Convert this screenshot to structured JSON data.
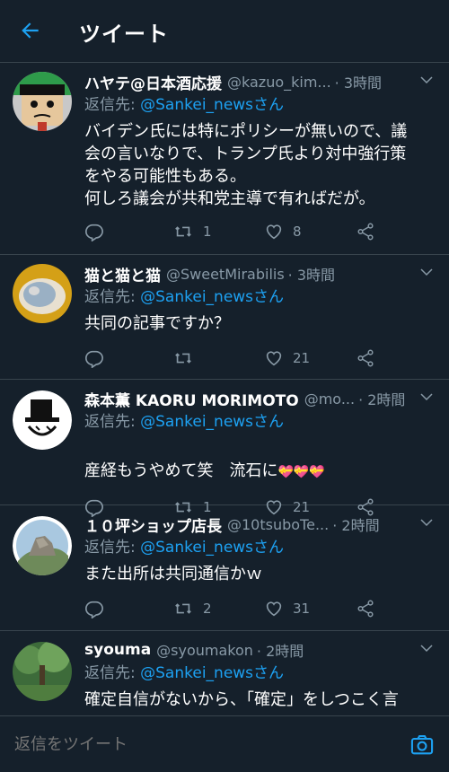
{
  "header": {
    "title": "ツイート",
    "back_icon": "arrow-left-icon",
    "accent": "#1da1f2"
  },
  "reply_prefix": "返信先:",
  "tweets": [
    {
      "name": "ハヤテ@日本酒応援",
      "handle": "@kazuo_kim...",
      "time": "· 3時間",
      "reply_to": "@Sankei_newsさん",
      "text": "バイデン氏には特にポリシーが無いので、議\n会の言いなりで、トランプ氏より対中強行策\nをやる可能性もある。\n何しろ議会が共和党主導で有ればだが。",
      "replies": "",
      "retweets": "1",
      "likes": "8"
    },
    {
      "name": "猫と猫と猫",
      "handle": "@SweetMirabilis",
      "time": "· 3時間",
      "reply_to": "@Sankei_newsさん",
      "text": "共同の記事ですか？",
      "replies": "",
      "retweets": "",
      "likes": "21"
    },
    {
      "name": "森本薫 KAORU MORIMOTO",
      "handle": "@mo...",
      "time": "· 2時間",
      "reply_to": "@Sankei_newsさん",
      "text": "産経もうやめて笑　流石に",
      "emoji": "💝💝💝",
      "replies": "",
      "retweets": "1",
      "likes": "21"
    },
    {
      "name": "１０坪ショップ店長",
      "handle": "@10tsuboTe...",
      "time": "· 2時間",
      "reply_to": "@Sankei_newsさん",
      "text": "また出所は共同通信かｗ",
      "replies": "",
      "retweets": "2",
      "likes": "31"
    },
    {
      "name": "syouma",
      "handle": "@syoumakon",
      "time": "· 2時間",
      "reply_to": "@Sankei_newsさん",
      "text": "確定自信がないから、「確定」をしつこく言",
      "replies": "",
      "retweets": "",
      "likes": ""
    }
  ],
  "compose": {
    "placeholder": "返信をツイート",
    "camera_icon": "camera-icon"
  },
  "colors": {
    "background": "#15202b",
    "divider": "#38444d",
    "secondary_text": "#8899a6",
    "mention": "#1da1f2"
  }
}
